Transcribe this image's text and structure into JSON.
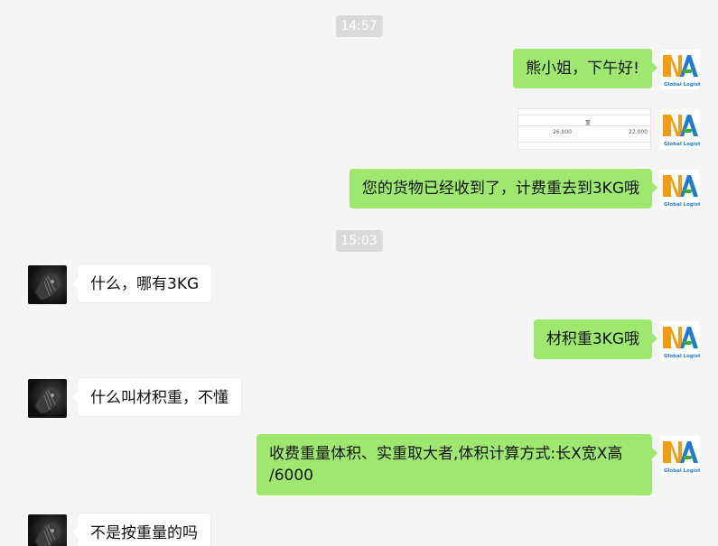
{
  "timestamps": [
    "14:57",
    "15:03"
  ],
  "messages": {
    "m1": "熊小姐，下午好!",
    "m3": "您的货物已经收到了，计费重去到3KG哦",
    "m4": "什么，哪有3KG",
    "m5": "材积重3KG哦",
    "m6": "什么叫材积重，不懂",
    "m7_line1": "收费重量体积、实重取大者,体积计算方式:长X宽X高",
    "m7_line2": "/6000",
    "m8": "不是按重量的吗"
  },
  "image_message": {
    "header": "重",
    "value_left": "26.000",
    "value_right": "22.000"
  },
  "avatar_me": {
    "logo_letters": "NA",
    "caption": "Global Logistics",
    "colors": {
      "orange": "#f39c12",
      "blue": "#1f7bd1",
      "green": "#3aa935"
    }
  },
  "colors": {
    "my_bubble": "#9fe870",
    "other_bubble": "#ffffff",
    "background": "#f5f5f5",
    "timestamp_bg": "#dadada"
  }
}
